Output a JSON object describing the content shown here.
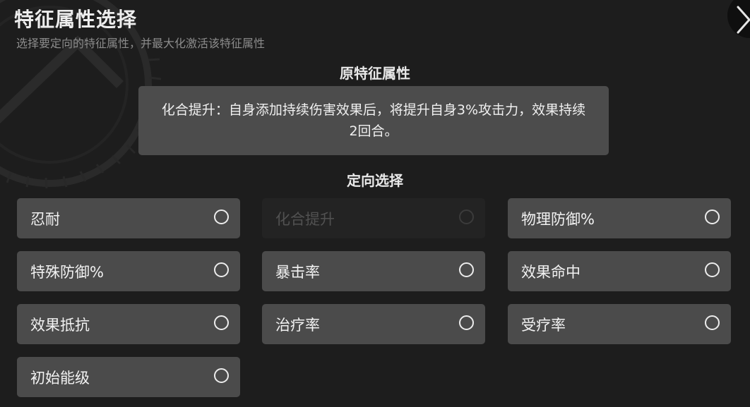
{
  "header": {
    "title": "特征属性选择",
    "subtitle": "选择要定向的特征属性，并最大化激活该特征属性",
    "close_icon": "chevron-right-icon"
  },
  "original": {
    "title": "原特征属性",
    "description": "化合提升：自身添加持续伤害效果后，将提升自身3%攻击力，效果持续2回合。"
  },
  "directed": {
    "title": "定向选择",
    "options": [
      {
        "label": "忍耐",
        "selected": false,
        "disabled": false
      },
      {
        "label": "化合提升",
        "selected": false,
        "disabled": true
      },
      {
        "label": "物理防御%",
        "selected": false,
        "disabled": false
      },
      {
        "label": "特殊防御%",
        "selected": false,
        "disabled": false
      },
      {
        "label": "暴击率",
        "selected": false,
        "disabled": false
      },
      {
        "label": "效果命中",
        "selected": false,
        "disabled": false
      },
      {
        "label": "效果抵抗",
        "selected": false,
        "disabled": false
      },
      {
        "label": "治疗率",
        "selected": false,
        "disabled": false
      },
      {
        "label": "受疗率",
        "selected": false,
        "disabled": false
      },
      {
        "label": "初始能级",
        "selected": false,
        "disabled": false
      }
    ]
  },
  "colors": {
    "background": "#1d1d1d",
    "panel": "#4b4b4b",
    "panel_disabled": "#232323",
    "text": "#f2f2f2",
    "subtext": "#8c8c8c"
  }
}
